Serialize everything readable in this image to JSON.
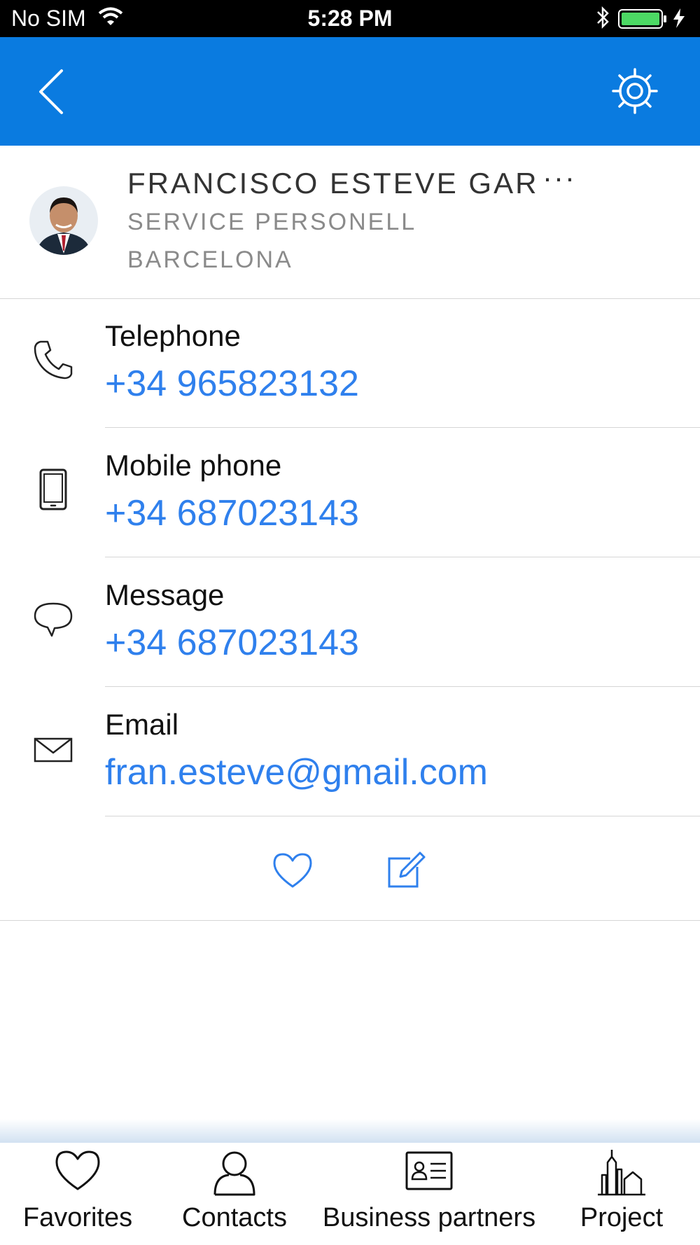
{
  "status_bar": {
    "carrier": "No SIM",
    "time": "5:28 PM"
  },
  "contact": {
    "name": "FRANCISCO ESTEVE GAR",
    "more": "···",
    "department": "SERVICE PERSONELL",
    "city": "BARCELONA"
  },
  "fields": [
    {
      "icon": "phone-icon",
      "label": "Telephone",
      "value": "+34 965823132"
    },
    {
      "icon": "mobile-phone-icon",
      "label": "Mobile phone",
      "value": "+34 687023143"
    },
    {
      "icon": "message-bubble-icon",
      "label": "Message",
      "value": "+34 687023143"
    },
    {
      "icon": "envelope-icon",
      "label": "Email",
      "value": "fran.esteve@gmail.com"
    }
  ],
  "tabs": [
    {
      "icon": "heart-icon",
      "label": "Favorites"
    },
    {
      "icon": "person-icon",
      "label": "Contacts"
    },
    {
      "icon": "id-card-icon",
      "label": "Business partners"
    },
    {
      "icon": "buildings-icon",
      "label": "Project"
    }
  ],
  "colors": {
    "nav_bar": "#0a7be0",
    "link": "#2f80ed",
    "battery": "#4cd964"
  }
}
